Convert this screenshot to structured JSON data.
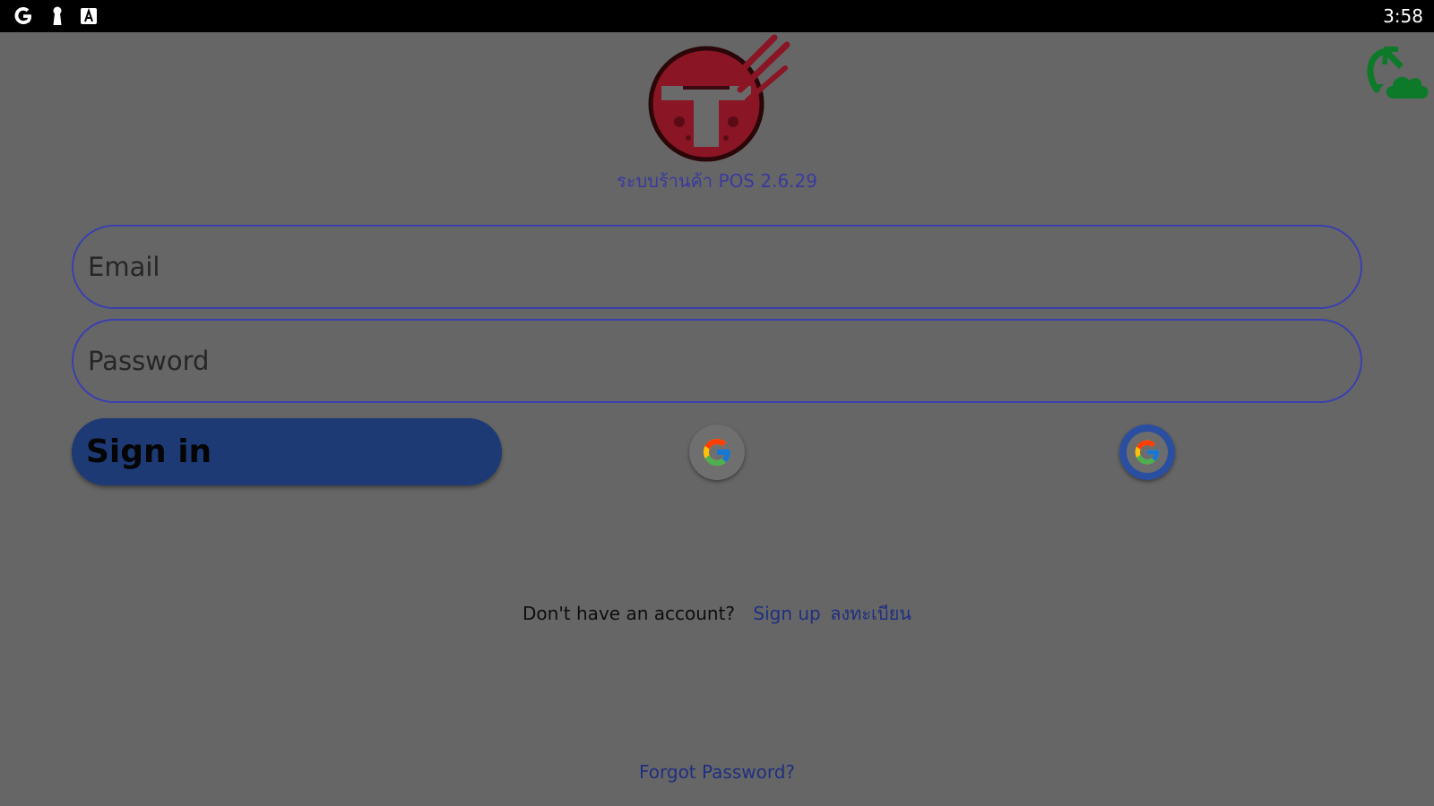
{
  "status_bar": {
    "time": "3:58",
    "icons": [
      "google-icon",
      "keyhole-icon",
      "text-a-icon"
    ]
  },
  "app": {
    "version_label": "ระบบร้านค้า POS 2.6.29"
  },
  "login_form": {
    "email_placeholder": "Email",
    "password_placeholder": "Password",
    "sign_in_label": "Sign in"
  },
  "signup": {
    "prompt": "Don't have an account?",
    "link_label": "Sign up",
    "link_label_th": "ลงทะเบียน"
  },
  "forgot_password_label": "Forgot Password?",
  "colors": {
    "background": "#666666",
    "status_bar": "#000000",
    "accent_blue": "#1d3a75",
    "field_border": "#3a3fae",
    "link": "#1f2f80",
    "sync_green": "#0d7a2a",
    "logo_red": "#8a1524"
  }
}
